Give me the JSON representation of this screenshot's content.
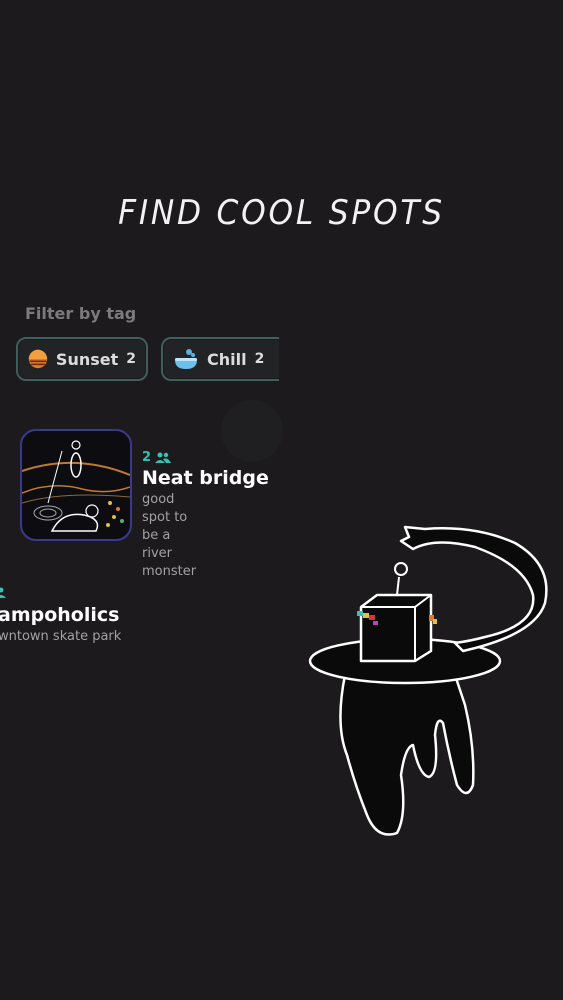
{
  "page": {
    "title": "FIND COOL SPOTS"
  },
  "filter": {
    "label": "Filter by tag",
    "tags": [
      {
        "label": "Sunset",
        "count": "2",
        "icon": "sunset-icon"
      },
      {
        "label": "Chill",
        "count": "2",
        "icon": "bathtub-icon"
      }
    ]
  },
  "spots": [
    {
      "count": "2",
      "title": "Neat bridge",
      "description_lines": [
        "good spot to be a",
        "river monster"
      ]
    },
    {
      "count": "",
      "title": "ampoholics",
      "description": "wntown skate park"
    }
  ],
  "colors": {
    "accent": "#38c0b0",
    "background": "#1c1a1c",
    "tag_border": "#3f5f5a",
    "thumb_border": "#3a3a8c"
  }
}
